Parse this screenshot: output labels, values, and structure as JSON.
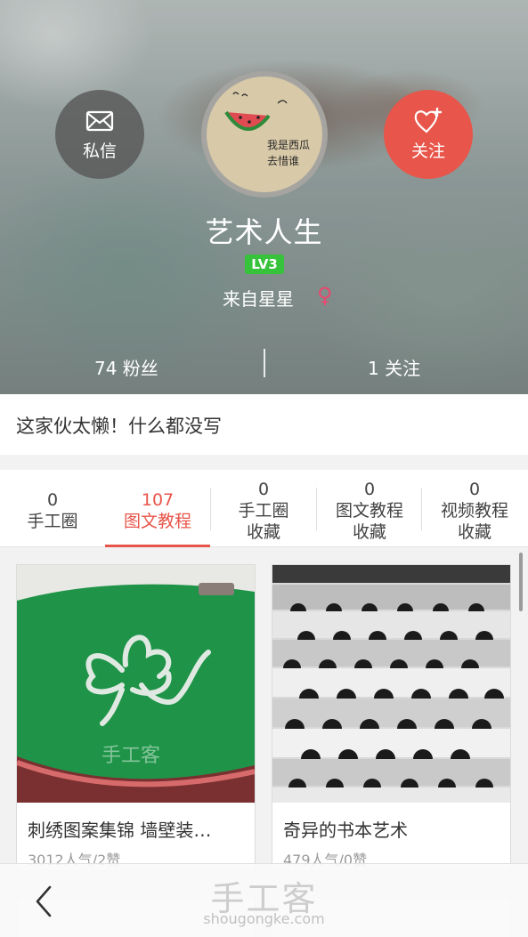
{
  "profile": {
    "username": "艺术人生",
    "level": "LV3",
    "location": "来自星星",
    "gender_symbol": "♀",
    "avatar_text": "我是西瓜 去惜谁",
    "actions": {
      "message_label": "私信",
      "follow_label": "关注"
    },
    "stats": {
      "fans": "74 粉丝",
      "following": "1 关注"
    }
  },
  "bio": "这家伙太懒！什么都没写",
  "tabs": [
    {
      "count": "0",
      "label": "手工圈",
      "label2": ""
    },
    {
      "count": "107",
      "label": "图文教程",
      "label2": ""
    },
    {
      "count": "0",
      "label": "手工圈",
      "label2": "收藏"
    },
    {
      "count": "0",
      "label": "图文教程",
      "label2": "收藏"
    },
    {
      "count": "0",
      "label": "视频教程",
      "label2": "收藏"
    }
  ],
  "active_tab": 1,
  "cards": [
    {
      "title": "刺绣图案集锦 墙壁装…",
      "meta": "3012人气/2赞",
      "watermark": "手工客"
    },
    {
      "title": "奇异的书本艺术",
      "meta": "479人气/0赞"
    }
  ],
  "bottom_bar": {
    "watermark_title": "手工客",
    "watermark_url": "shougongke.com"
  },
  "colors": {
    "accent": "#e8554a",
    "level_badge": "#37c23b",
    "gender": "#e9496e"
  },
  "icons": {
    "message": "envelope-icon",
    "follow": "heart-plus-icon",
    "back": "chevron-left-icon"
  }
}
